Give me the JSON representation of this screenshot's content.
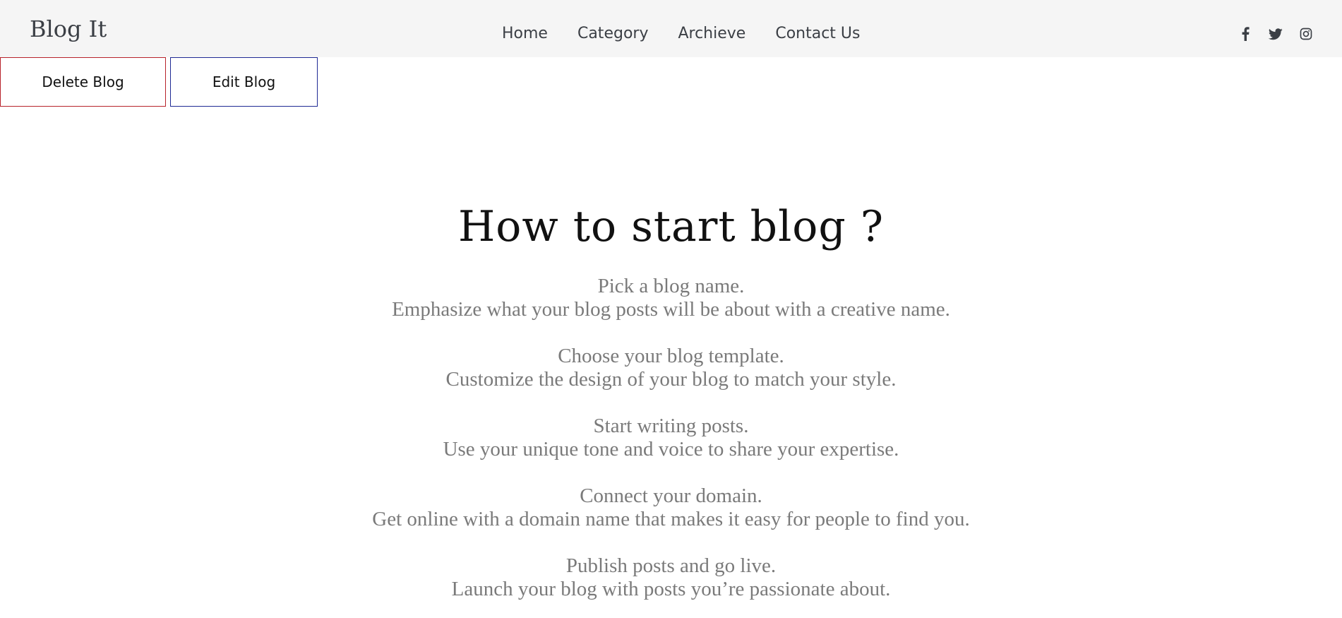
{
  "header": {
    "brand": "Blog It",
    "nav": [
      {
        "label": "Home"
      },
      {
        "label": "Category"
      },
      {
        "label": "Archieve"
      },
      {
        "label": "Contact Us"
      }
    ],
    "social": [
      {
        "icon": "facebook-icon"
      },
      {
        "icon": "twitter-icon"
      },
      {
        "icon": "instagram-icon"
      }
    ]
  },
  "actions": {
    "delete_label": "Delete Blog",
    "edit_label": "Edit Blog",
    "delete_color": "#b8232b",
    "edit_color": "#1f2a94"
  },
  "post": {
    "title": "How to start blog ?",
    "steps": [
      {
        "heading": "Pick a blog name.",
        "text": "Emphasize what your blog posts will be about with a creative name."
      },
      {
        "heading": "Choose your blog template.",
        "text": "Customize the design of your blog to match your style."
      },
      {
        "heading": "Start writing posts.",
        "text": "Use your unique tone and voice to share your expertise."
      },
      {
        "heading": "Connect your domain.",
        "text": "Get online with a domain name that makes it easy for people to find you."
      },
      {
        "heading": "Publish posts and go live.",
        "text": "Launch your blog with posts you’re passionate about."
      }
    ]
  }
}
